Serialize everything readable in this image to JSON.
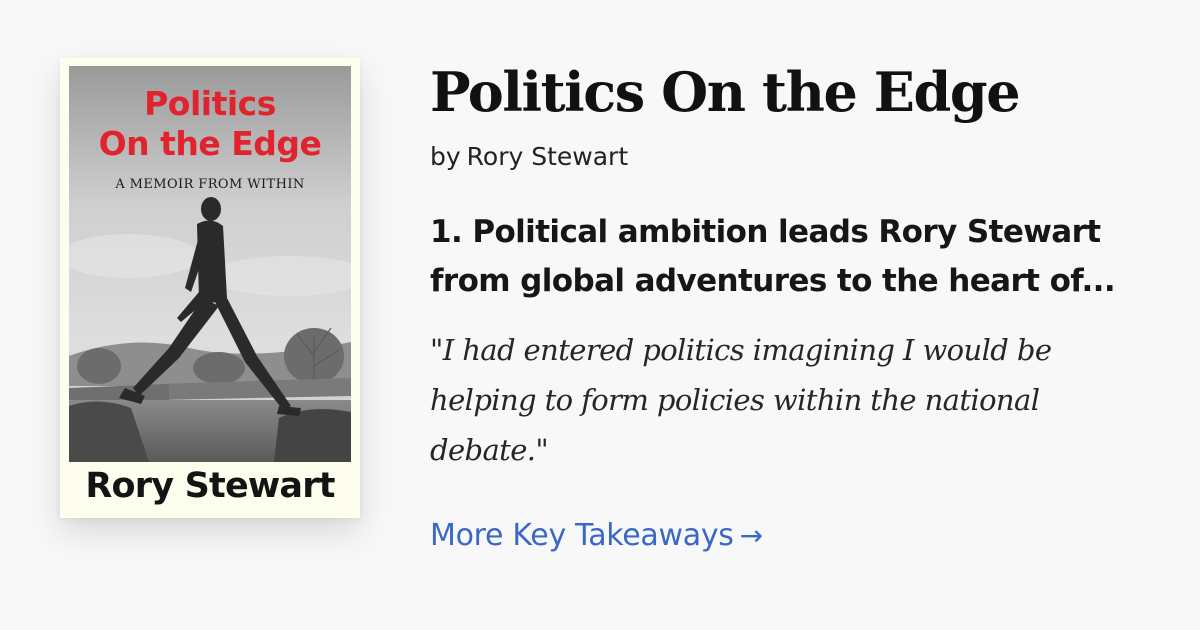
{
  "book": {
    "title": "Politics On the Edge",
    "byline_prefix": "by",
    "author": "Rory Stewart",
    "cover": {
      "title_line1": "Politics",
      "title_line2": "On the Edge",
      "subtitle": "A MEMOIR FROM WITHIN",
      "author": "Rory Stewart",
      "title_color": "#e1232d",
      "background_color": "#fdfeed"
    }
  },
  "takeaway": {
    "line1": "1. Political ambition leads Rory Stewart",
    "line2": "from global adventures to the heart of..."
  },
  "quote": {
    "line1": "\"I had entered politics imagining I would be",
    "line2": "helping to form policies within the national",
    "line3": "debate.\""
  },
  "more_link": {
    "label": "More Key Takeaways",
    "icon": "arrow-right-icon",
    "arrow": "→",
    "color": "#3b68c5"
  }
}
